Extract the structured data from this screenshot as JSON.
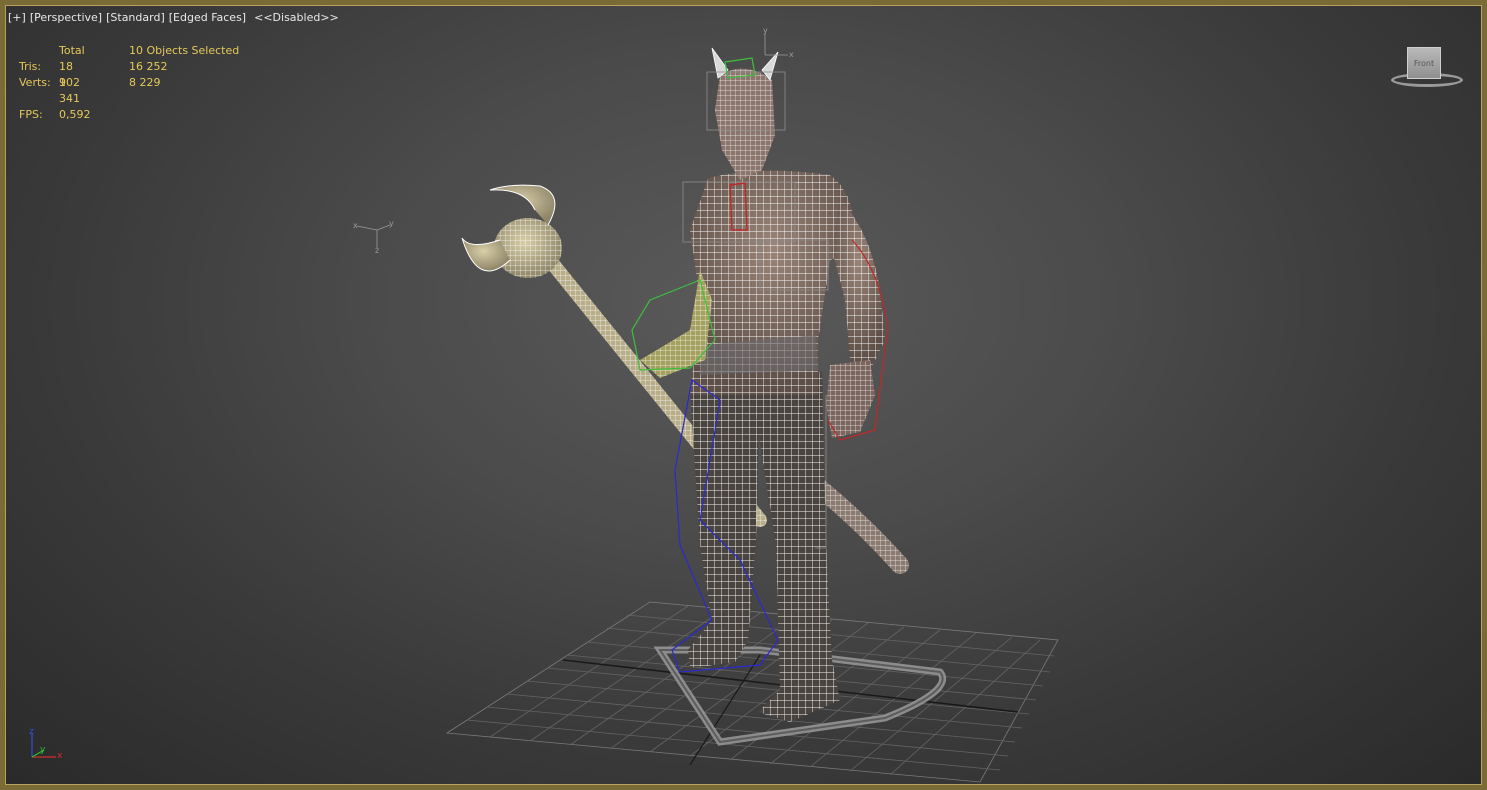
{
  "viewport": {
    "labels": [
      "[+]",
      "[Perspective]",
      "[Standard]",
      "[Edged Faces]",
      "<<Disabled>>"
    ]
  },
  "stats": {
    "header_total": "Total",
    "header_selected": "10 Objects Selected",
    "tris_label": "Tris:",
    "tris_total": "18 102",
    "tris_selected": "16 252",
    "verts_label": "Verts:",
    "verts_total": "9 341",
    "verts_selected": "8 229",
    "fps_label": "FPS:",
    "fps_value": "0,592"
  },
  "viewcube": {
    "face": "Front",
    "icon": "viewcube-icon"
  },
  "gizmos": {
    "world_axis": {
      "x": "x",
      "y": "y",
      "z": "z"
    },
    "object_axis": {
      "x": "x",
      "y": "y",
      "z": "z"
    },
    "head_axis": {
      "x": "x",
      "y": "y"
    }
  },
  "colors": {
    "viewport_border": "#7a6a36",
    "stats_text": "#e6c85a",
    "wireframe": "#ffffff",
    "selection_green": "#3fbf3f",
    "selection_red": "#c02828",
    "selection_blue": "#2a2ad0",
    "axis_x": "#d03030",
    "axis_y": "#30c030",
    "axis_z": "#3050e0"
  }
}
